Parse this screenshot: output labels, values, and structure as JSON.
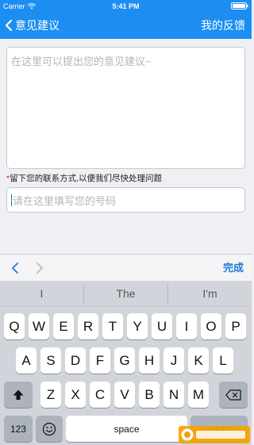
{
  "status_bar": {
    "carrier": "Carrier",
    "time": "5:41 PM"
  },
  "nav": {
    "back_label": "意见建议",
    "right_label": "我的反馈"
  },
  "form": {
    "feedback_placeholder": "在这里可以提出您的意见建议~",
    "contact_required_mark": "*",
    "contact_hint": "留下您的联系方式,以便我们尽快处理问题",
    "phone_placeholder": "请在这里填写您的号码"
  },
  "accessory_bar": {
    "done_label": "完成"
  },
  "keyboard": {
    "predictions": [
      "I",
      "The",
      "I'm"
    ],
    "row1": [
      "Q",
      "W",
      "E",
      "R",
      "T",
      "Y",
      "U",
      "I",
      "O",
      "P"
    ],
    "row2": [
      "A",
      "S",
      "D",
      "F",
      "G",
      "H",
      "J",
      "K",
      "L"
    ],
    "row3": [
      "Z",
      "X",
      "C",
      "V",
      "B",
      "N",
      "M"
    ],
    "numbers_label": "123",
    "space_label": "space",
    "return_label": "return",
    "emoji_icon": "emoji-icon",
    "shift_icon": "shift-icon",
    "delete_icon": "delete-icon"
  },
  "colors": {
    "nav_blue": "#1c8ef2",
    "accent_blue": "#1c7bd9",
    "required_red": "#e02020"
  }
}
